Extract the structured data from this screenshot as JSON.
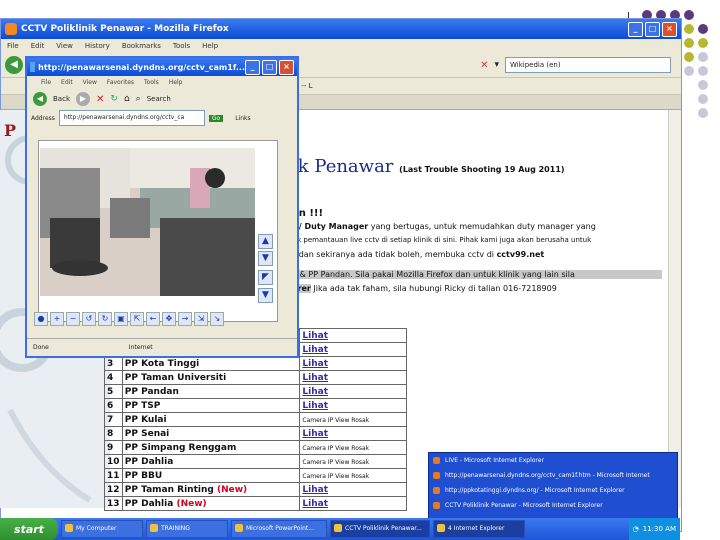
{
  "firefox": {
    "title": "CCTV Poliklinik Penawar - Mozilla Firefox",
    "menu": [
      "File",
      "Edit",
      "View",
      "History",
      "Bookmarks",
      "Tools",
      "Help"
    ],
    "search_placeholder": "Wikipedia (en)"
  },
  "popup": {
    "title": "http://penawarsenai.dyndns.org/cctv_cam1f...",
    "menu": [
      "File",
      "Edit",
      "View",
      "Favorites",
      "Tools",
      "Help"
    ],
    "back_label": "Back",
    "search_label": "Search",
    "address_label": "Address",
    "address_value": "http://penawarsenai.dyndns.org/cctv_ca",
    "go_label": "Go",
    "links_label": "Links",
    "status_left": "Done",
    "status_zone": "Internet"
  },
  "page": {
    "heading": "ik Penawar",
    "heading_sub": "(Last Trouble Shooting 19 Aug 2011)",
    "alert": "an !!!",
    "line1_bold": "O/ Duty Manager",
    "line1_rest": " yang bertugas, untuk memudahkan duty manager yang",
    "line2": "Uk pemantauan live cctv di setiap klinik di sini. Pihak kami juga akan berusaha untuk",
    "line3_pre": "s dan sekiranya ada tidak boleh, membuka cctv di ",
    "line3_url": "cctv99.net",
    "line4": "1 & PP Pandan. Sila pakai Mozilla Firefox dan untuk klinik yang lain sila",
    "line5_pre": "orer",
    "line5_rest": " Jika ada tak faham, sila hubungi Ricky di talian 016-7218909",
    "bookmark_text": "Bss -- L"
  },
  "rows": [
    {
      "no": "",
      "name": "",
      "link": "Lihat",
      "new": ""
    },
    {
      "no": "",
      "name": "",
      "link": "Lihat",
      "new": ""
    },
    {
      "no": "3",
      "name": "PP Kota Tinggi",
      "link": "Lihat",
      "new": ""
    },
    {
      "no": "4",
      "name": "PP Taman Universiti",
      "link": "Lihat",
      "new": ""
    },
    {
      "no": "5",
      "name": "PP Pandan",
      "link": "Lihat",
      "new": ""
    },
    {
      "no": "6",
      "name": "PP TSP",
      "link": "Lihat",
      "new": ""
    },
    {
      "no": "7",
      "name": "PP Kulai",
      "link": "Camera IP View Rosak",
      "new": ""
    },
    {
      "no": "8",
      "name": "PP Senai",
      "link": "Lihat",
      "new": ""
    },
    {
      "no": "9",
      "name": "PP Simpang Renggam",
      "link": "Camera IP View Rosak",
      "new": ""
    },
    {
      "no": "10",
      "name": "PP Dahlia",
      "link": "Camera IP View Rosak",
      "new": ""
    },
    {
      "no": "11",
      "name": "PP BBU",
      "link": "Camera IP View Rosak",
      "new": ""
    },
    {
      "no": "12",
      "name": "PP Taman Rinting",
      "link": "Lihat",
      "new": "(New)"
    },
    {
      "no": "13",
      "name": "PP Dahlia",
      "link": "Lihat",
      "new": "(New)"
    }
  ],
  "taskbar": {
    "start": "start",
    "tasks": [
      "My Computer",
      "TRAINING",
      "Microsoft PowerPoint...",
      "CCTV Poliklinik Penawar...",
      "4 Internet Explorer"
    ],
    "clock": "11:30 AM"
  },
  "tasklist": [
    "LIVE - Microsoft Internet Explorer",
    "http://penawarsenai.dyndns.org/cctv_cam1f.htm - Microsoft Internet",
    "http://ppkotatinggi.dyndns.org/ - Microsoft Internet Explorer",
    "CCTV Poliklinik Penawar - Microsoft Internet Explorer"
  ],
  "colors": {
    "accent": "#0a4bd6",
    "alert": "#d4001e",
    "link": "#3a2aa8"
  }
}
